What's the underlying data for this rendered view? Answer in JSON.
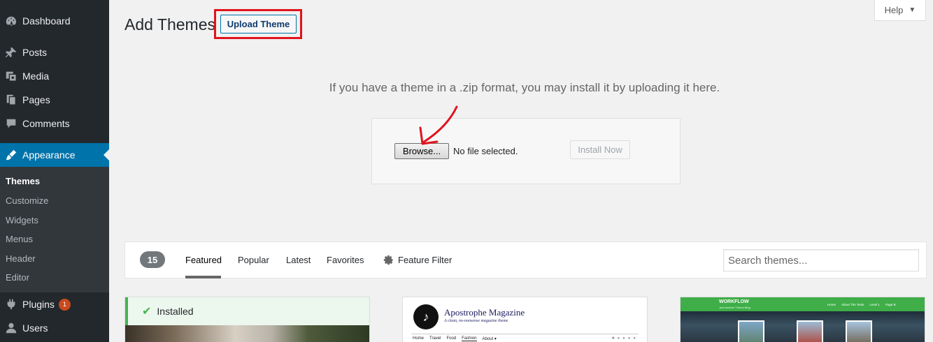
{
  "sidebar": {
    "items": [
      {
        "label": "Dashboard",
        "icon": "dashboard-icon"
      },
      {
        "label": "Posts",
        "icon": "pin-icon"
      },
      {
        "label": "Media",
        "icon": "media-icon"
      },
      {
        "label": "Pages",
        "icon": "pages-icon"
      },
      {
        "label": "Comments",
        "icon": "comment-icon"
      },
      {
        "label": "Appearance",
        "icon": "brush-icon"
      },
      {
        "label": "Plugins",
        "icon": "plugin-icon",
        "badge": "1"
      },
      {
        "label": "Users",
        "icon": "user-icon"
      }
    ],
    "submenu": [
      "Themes",
      "Customize",
      "Widgets",
      "Menus",
      "Header",
      "Editor"
    ]
  },
  "header": {
    "title": "Add Themes",
    "upload_button": "Upload Theme",
    "help": "Help"
  },
  "upload": {
    "instructions": "If you have a theme in a .zip format, you may install it by uploading it here.",
    "browse_button": "Browse...",
    "file_status": "No file selected.",
    "install_button": "Install Now"
  },
  "filter": {
    "count": "15",
    "tabs": [
      "Featured",
      "Popular",
      "Latest",
      "Favorites"
    ],
    "feature_filter": "Feature Filter",
    "search_placeholder": "Search themes..."
  },
  "themes": {
    "installed_label": "Installed",
    "apostrophe": {
      "title": "Apostrophe Magazine",
      "tagline": "A clean, no-nonsense magazine theme",
      "nav": [
        "Home",
        "Travel",
        "Food",
        "Fashion",
        "About ▾"
      ]
    },
    "workflow": {
      "title": "WORKFLOW",
      "subtitle": "Just Another Theme Blog",
      "nav": [
        "Home",
        "About The Tests",
        "Level 1",
        "Page B"
      ]
    }
  },
  "colors": {
    "sidebar_bg": "#23282d",
    "active_blue": "#0073aa",
    "highlight_red": "#e0141e",
    "installed_green": "#46b450"
  }
}
